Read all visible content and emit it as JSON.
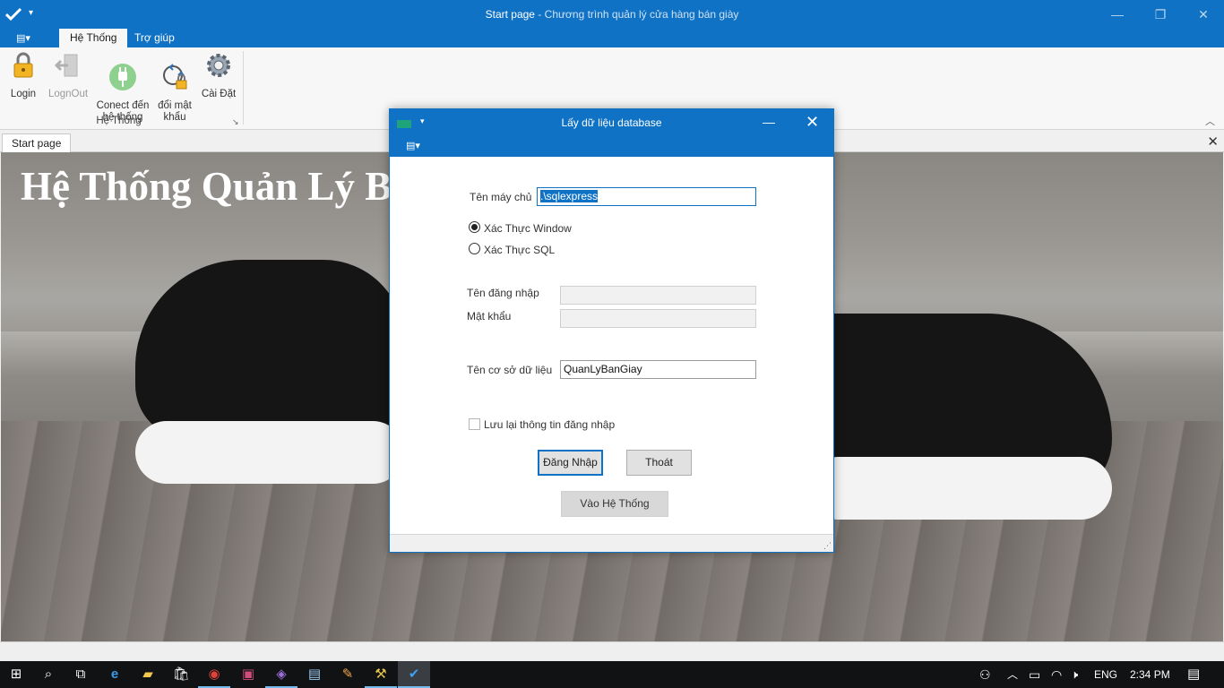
{
  "titlebar": {
    "title": "Start page",
    "subtitle": " - Chương trình quản lý cửa hàng bán giày",
    "qat_glyph": "▾",
    "min_glyph": "—",
    "restore_glyph": "❐",
    "close_glyph": "✕"
  },
  "ribbon": {
    "tabs": [
      {
        "label": "Hệ Thống",
        "active": true
      },
      {
        "label": "Trợ giúp",
        "active": false
      }
    ],
    "menu_glyph": "▤▾",
    "buttons": [
      {
        "label": "Login",
        "icon": "padlock-icon",
        "enabled": true
      },
      {
        "label": "LognOut",
        "icon": "logout-icon",
        "enabled": false
      },
      {
        "label": "Conect đến\nhệ thống",
        "icon": "plug-icon",
        "enabled": true
      },
      {
        "label": "đổi mật\nkhẩu",
        "icon": "change-password-icon",
        "enabled": true
      },
      {
        "label": "Cài Đặt",
        "icon": "gear-icon",
        "enabled": true
      }
    ],
    "group_label": "Hệ Thống",
    "launcher_glyph": "↘",
    "collapse_glyph": "︿"
  },
  "document": {
    "tab_label": "Start page",
    "close_glyph": "✕",
    "heading": "Hệ Thống Quản Lý Bán Giày"
  },
  "dialog": {
    "title": "Lấy dữ liệu database",
    "qat_glyph": "▾",
    "menu_glyph": "▤▾",
    "min_glyph": "—",
    "close_glyph": "✕",
    "server_label": "Tên máy chủ",
    "server_value": ".\\sqlexpress",
    "auth_windows_label": "Xác Thực Window",
    "auth_sql_label": "Xác Thực SQL",
    "auth_selected": "windows",
    "username_label": "Tên đăng nhập",
    "username_value": "",
    "password_label": "Mật khẩu",
    "password_value": "",
    "database_label": "Tên cơ sở dữ liệu",
    "database_value": "QuanLyBanGiay",
    "remember_label": "Lưu lại thông tin đăng nhập",
    "remember_checked": false,
    "login_button": "Đăng Nhập",
    "exit_button": "Thoát",
    "enter_button": "Vào Hệ Thống",
    "grip_glyph": "⋰"
  },
  "taskbar": {
    "items": [
      {
        "name": "start-button",
        "glyph": "⊞"
      },
      {
        "name": "search-icon",
        "glyph": "⌕"
      },
      {
        "name": "task-view-icon",
        "glyph": "⧉"
      },
      {
        "name": "edge-icon",
        "glyph": "e"
      },
      {
        "name": "file-explorer-icon",
        "glyph": "▰"
      },
      {
        "name": "store-icon",
        "glyph": "🛍"
      },
      {
        "name": "chrome-icon",
        "glyph": "◉"
      },
      {
        "name": "app-icon-1",
        "glyph": "▣"
      },
      {
        "name": "visual-studio-icon",
        "glyph": "◈"
      },
      {
        "name": "notepad-icon",
        "glyph": "▤"
      },
      {
        "name": "paint-icon",
        "glyph": "✎"
      },
      {
        "name": "tool-icon",
        "glyph": "⚒"
      },
      {
        "name": "app-running-icon",
        "glyph": "✔"
      }
    ],
    "tray": {
      "people_glyph": "⚇",
      "chevron_glyph": "︿",
      "battery_glyph": "▭",
      "wifi_glyph": "◠",
      "volume_glyph": "🕨",
      "language": "ENG",
      "time": "2:34 PM",
      "notification_glyph": "▤"
    }
  },
  "colors": {
    "accent": "#0f72c4"
  }
}
